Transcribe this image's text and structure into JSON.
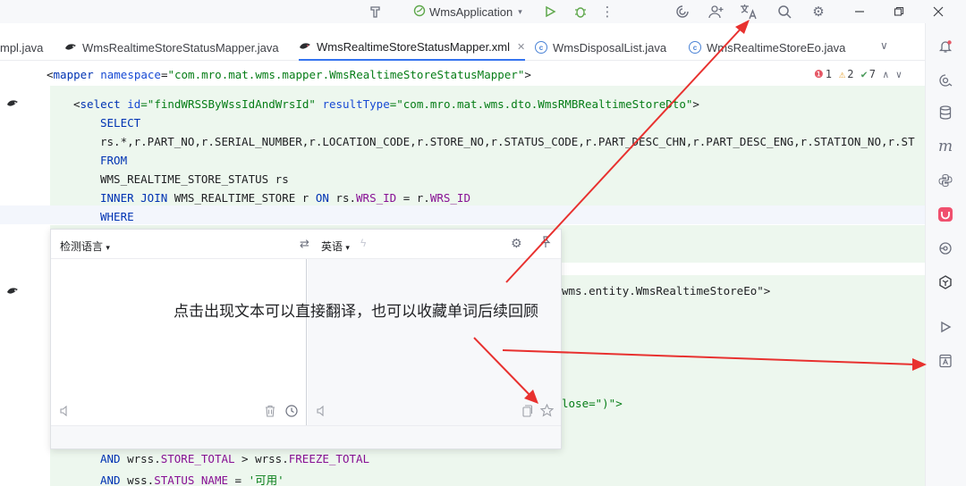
{
  "titlebar": {
    "run_config": "WmsApplication"
  },
  "tabs": [
    {
      "label": "mpl.java",
      "icon": "class-icon"
    },
    {
      "label": "WmsRealtimeStoreStatusMapper.java",
      "icon": "interface-icon"
    },
    {
      "label": "WmsRealtimeStoreStatusMapper.xml",
      "icon": "mybatis-icon",
      "active": true
    },
    {
      "label": "WmsDisposalList.java",
      "icon": "class-icon"
    },
    {
      "label": "WmsRealtimeStoreEo.java",
      "icon": "class-icon"
    }
  ],
  "namespace_line": {
    "lt": "<",
    "tag": "mapper",
    "attr": " namespace",
    "eq": "=",
    "value": "\"com.mro.mat.wms.mapper.WmsRealtimeStoreStatusMapper\"",
    "gt": ">"
  },
  "inspections": {
    "errors": "1",
    "warnings": "2",
    "ok": "7"
  },
  "code": {
    "select_open": "<",
    "select_tag": "select",
    "select_id_attr": " id",
    "select_id_val": "=\"findWRSSByWssIdAndWrsId\"",
    "select_rt_attr": " resultType",
    "select_rt_val": "=\"com.mro.mat.wms.dto.WmsRMBRealtimeStoreDto\"",
    "select_close": ">",
    "kw_select": "SELECT",
    "columns": "rs.*,r.PART_NO,r.SERIAL_NUMBER,r.LOCATION_CODE,r.STORE_NO,r.STATUS_CODE,r.PART_DESC_CHN,r.PART_DESC_ENG,r.STATION_NO,r.ST",
    "kw_from": "FROM",
    "table1": "WMS_REALTIME_STORE_STATUS rs",
    "kw_inner_join": "INNER JOIN",
    "table2": " WMS_REALTIME_STORE r ",
    "kw_on": "ON",
    "on_a": " rs.",
    "on_a_fld": "WRS_ID",
    "on_eq": " = r.",
    "on_b_fld": "WRS_ID",
    "kw_where": "WHERE",
    "result_tail": "wms.entity.WmsRealtimeStoreEo\">",
    "foreach_tail": "lose=\")\">",
    "kw_and1": "AND",
    "and1_a": " wrss.",
    "and1_a_fld": "STORE_TOTAL",
    "and1_op": " > wrss.",
    "and1_b_fld": "FREEZE_TOTAL",
    "kw_and2": "AND",
    "and2_a": " wss.",
    "and2_a_fld": "STATUS_NAME",
    "and2_op": " = ",
    "and2_val": "'可用'"
  },
  "translate_popup": {
    "source_lang": "检测语言",
    "target_lang": "英语"
  },
  "annotation": {
    "text": "点击出现文本可以直接翻译，也可以收藏单词后续回顾"
  },
  "colors": {
    "accent": "#3574f0",
    "arrow": "#e8312f",
    "changed_bg": "#edf7ee"
  }
}
